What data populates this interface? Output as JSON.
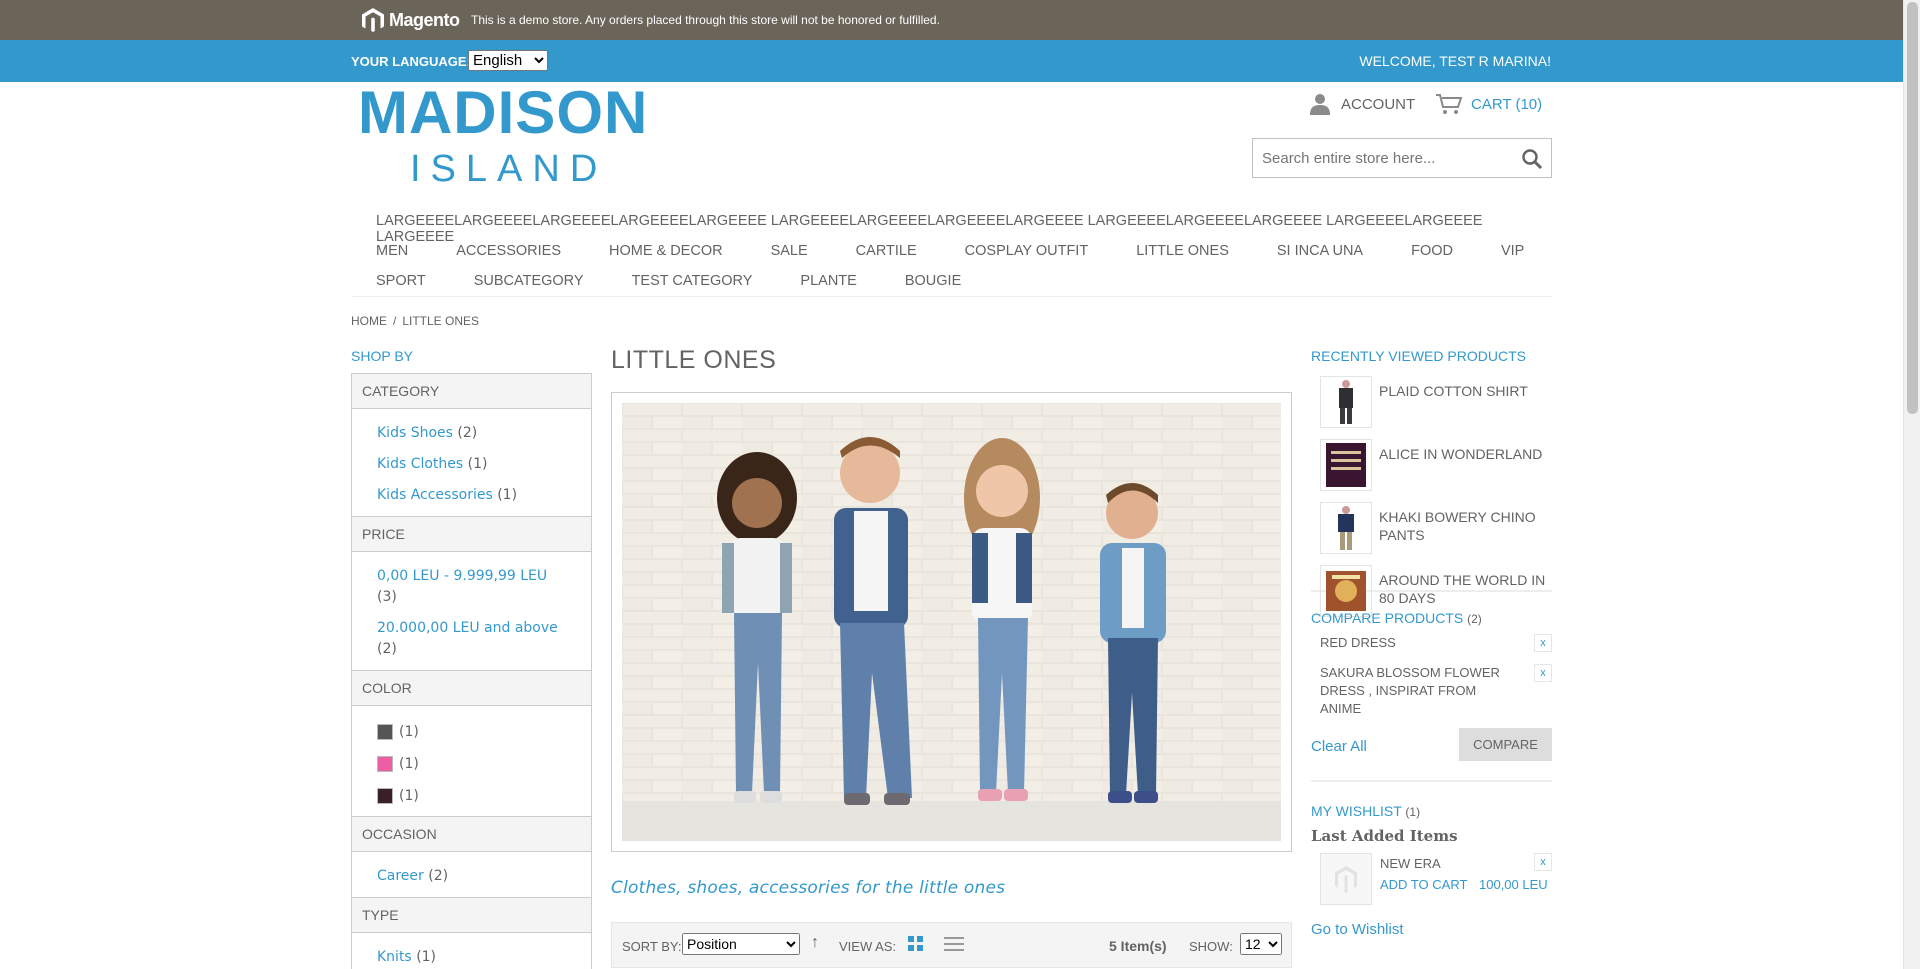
{
  "colors": {
    "accent": "#3399cc",
    "demo_bar": "#6b6459",
    "text": "#636363"
  },
  "demo": {
    "brand": "Magento",
    "notice": "This is a demo store. Any orders placed through this store will not be honored or fulfilled."
  },
  "header": {
    "language_label": "YOUR LANGUAGE:",
    "language_value": "English",
    "welcome": "WELCOME, TEST R MARINA!",
    "logo_line1": "MADISON",
    "logo_line2": "ISLAND",
    "account": "ACCOUNT",
    "cart": "CART (10)",
    "search_placeholder": "Search entire store here..."
  },
  "nav": {
    "row1": [
      "LARGEEEELARGEEEELARGEEEELARGEEEELARGEEEE LARGEEEELARGEEEELARGEEEELARGEEEE LARGEEEELARGEEEELARGEEEE LARGEEEELARGEEEE LARGEEEE"
    ],
    "row2": [
      "MEN",
      "ACCESSORIES",
      "HOME & DECOR",
      "SALE",
      "CARTILE",
      "COSPLAY OUTFIT",
      "LITTLE ONES",
      "SI INCA UNA",
      "FOOD",
      "VIP"
    ],
    "row3": [
      "SPORT",
      "SUBCATEGORY",
      "TEST CATEGORY",
      "PLANTE",
      "BOUGIE"
    ]
  },
  "breadcrumb": {
    "home": "HOME",
    "sep": "/",
    "current": "LITTLE ONES"
  },
  "sidebar": {
    "shop_by": "SHOP BY",
    "category": {
      "title": "CATEGORY",
      "items": [
        {
          "label": "Kids Shoes",
          "count": "(2)"
        },
        {
          "label": "Kids Clothes",
          "count": "(1)"
        },
        {
          "label": "Kids Accessories",
          "count": "(1)"
        }
      ]
    },
    "price": {
      "title": "PRICE",
      "items": [
        {
          "label": "0,00 LEU - 9.999,99 LEU",
          "count": "(3)"
        },
        {
          "label": "20.000,00 LEU and above",
          "count": "(2)"
        }
      ]
    },
    "color": {
      "title": "COLOR",
      "swatches": [
        {
          "color": "#555555",
          "count": "(1)"
        },
        {
          "color": "#ee5ea5",
          "count": "(1)"
        },
        {
          "color": "#3a1f2a",
          "count": "(1)"
        }
      ]
    },
    "occasion": {
      "title": "OCCASION",
      "items": [
        {
          "label": "Career",
          "count": "(2)"
        }
      ]
    },
    "type": {
      "title": "TYPE",
      "items": [
        {
          "label": "Knits",
          "count": "(1)"
        }
      ]
    }
  },
  "main": {
    "title": "LITTLE ONES",
    "description": "Clothes, shoes, accessories for the little ones",
    "toolbar": {
      "sort_label": "SORT BY:",
      "sort_value": "Position",
      "view_label": "VIEW AS:",
      "items": "5 Item(s)",
      "show_label": "SHOW:",
      "show_value": "12"
    }
  },
  "right": {
    "recently_viewed": {
      "title": "RECENTLY VIEWED PRODUCTS",
      "items": [
        "PLAID COTTON SHIRT",
        "ALICE IN WONDERLAND",
        "KHAKI BOWERY CHINO PANTS",
        "AROUND THE WORLD IN 80 DAYS"
      ]
    },
    "compare": {
      "title": "COMPARE PRODUCTS",
      "count": "(2)",
      "items": [
        "RED DRESS",
        "SAKURA BLOSSOM FLOWER DRESS , INSPIRAT FROM ANIME"
      ],
      "clear": "Clear All",
      "button": "COMPARE",
      "remove": "x"
    },
    "wishlist": {
      "title": "MY WISHLIST",
      "count": "(1)",
      "last_added": "Last Added Items",
      "item": {
        "name": "NEW ERA",
        "add": "ADD TO CART",
        "price": "100,00 LEU",
        "remove": "x"
      },
      "go": "Go to Wishlist"
    }
  }
}
